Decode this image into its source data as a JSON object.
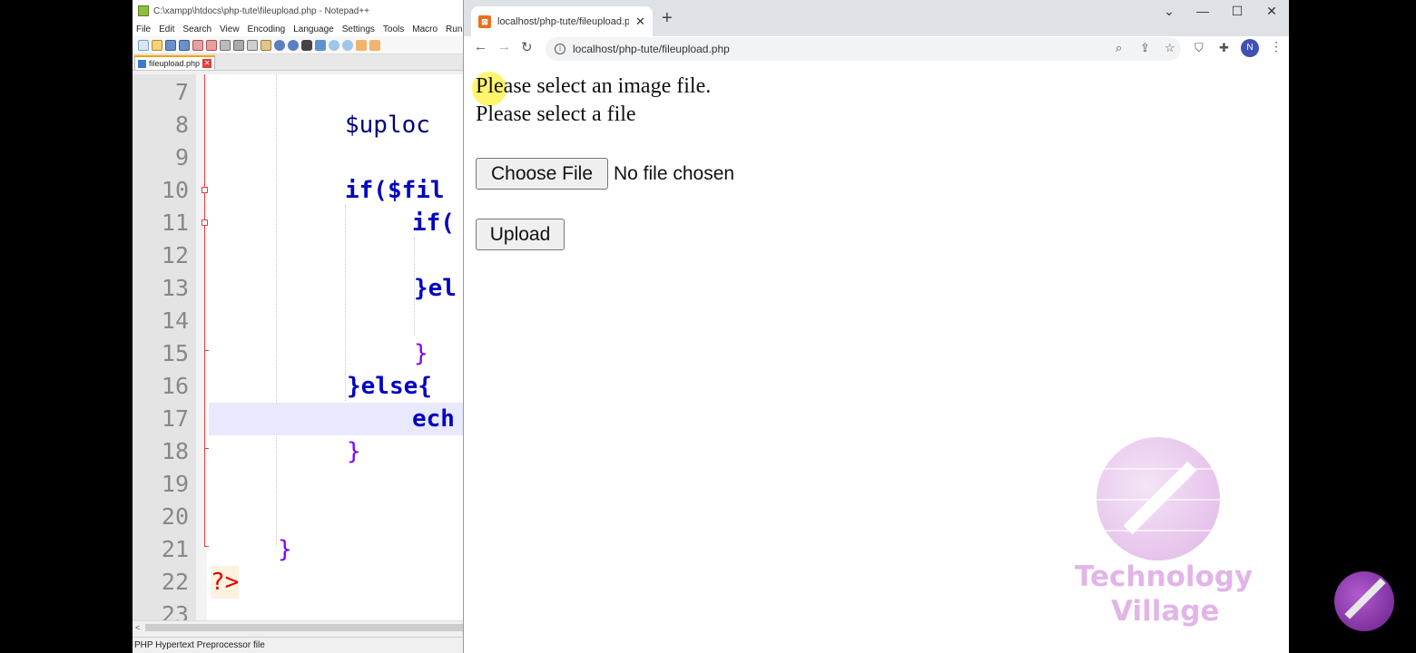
{
  "notepad": {
    "title": "C:\\xampp\\htdocs\\php-tute\\fileupload.php - Notepad++",
    "menu": [
      "File",
      "Edit",
      "Search",
      "View",
      "Encoding",
      "Language",
      "Settings",
      "Tools",
      "Macro",
      "Run"
    ],
    "tab_label": "fileupload.php",
    "status_text": "PHP Hypertext Preprocessor file",
    "lines": [
      {
        "num": "7",
        "code": ""
      },
      {
        "num": "8",
        "code": "$uploc"
      },
      {
        "num": "9",
        "code": ""
      },
      {
        "num": "10",
        "code": "if($fil"
      },
      {
        "num": "11",
        "code": "if("
      },
      {
        "num": "12",
        "code": ""
      },
      {
        "num": "13",
        "code": "}el"
      },
      {
        "num": "14",
        "code": ""
      },
      {
        "num": "15",
        "code": "}"
      },
      {
        "num": "16",
        "code": "}else{"
      },
      {
        "num": "17",
        "code": "ech"
      },
      {
        "num": "18",
        "code": "}"
      },
      {
        "num": "19",
        "code": ""
      },
      {
        "num": "20",
        "code": ""
      },
      {
        "num": "21",
        "code": "}"
      },
      {
        "num": "22",
        "code": "?>"
      },
      {
        "num": "23",
        "code": ""
      }
    ]
  },
  "browser": {
    "tab_title": "localhost/php-tute/fileupload.ph",
    "url": "localhost/php-tute/fileupload.php",
    "profile_initial": "N"
  },
  "page": {
    "message_line1": "Please select an image file.",
    "message_line2": "Please select a file",
    "choose_file_label": "Choose File",
    "file_status": "No file chosen",
    "upload_label": "Upload"
  },
  "watermark": {
    "line1": "Technology",
    "line2": "Village"
  }
}
